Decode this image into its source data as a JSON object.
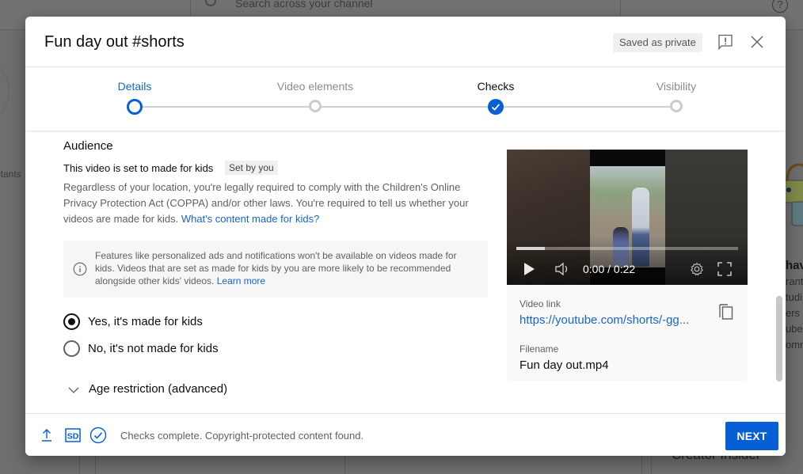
{
  "background": {
    "search_placeholder": "Search across your channel",
    "help_glyph": "?",
    "left_partial_text": "ltants",
    "right_partial_heading": "hav",
    "right_partial_lines": [
      "rant",
      "tudi",
      "ers a",
      "ube.",
      "omn"
    ],
    "creator_partial": "Creator Insider"
  },
  "dialog": {
    "title": "Fun day out #shorts",
    "saved_badge": "Saved as private",
    "feedback_icon": "feedback-icon",
    "close_icon": "close-icon"
  },
  "stepper": {
    "steps": [
      {
        "label": "Details",
        "state": "active"
      },
      {
        "label": "Video elements",
        "state": "pending"
      },
      {
        "label": "Checks",
        "state": "done"
      },
      {
        "label": "Visibility",
        "state": "pending"
      }
    ]
  },
  "audience": {
    "title": "Audience",
    "status": "This video is set to made for kids",
    "set_by_badge": "Set by you",
    "description": "Regardless of your location, you're legally required to comply with the Children's Online Privacy Protection Act (COPPA) and/or other laws. You're required to tell us whether your videos are made for kids. ",
    "description_link": "What's content made for kids?",
    "info_text": "Features like personalized ads and notifications won't be available on videos made for kids. Videos that are set as made for kids by you are more likely to be recommended alongside other kids' videos. ",
    "info_link": "Learn more",
    "options": [
      {
        "label": "Yes, it's made for kids",
        "checked": true
      },
      {
        "label": "No, it's not made for kids",
        "checked": false
      }
    ],
    "age_restriction_label": "Age restriction (advanced)"
  },
  "video": {
    "current_time": "0:00",
    "duration": "0:22",
    "time_display": "0:00 / 0:22",
    "buffered_fraction": 0.13,
    "link_label": "Video link",
    "link": "https://youtube.com/shorts/-gg...",
    "filename_label": "Filename",
    "filename": "Fun day out.mp4"
  },
  "footer": {
    "status": "Checks complete. Copyright-protected content found.",
    "sd_badge": "SD",
    "next_label": "NEXT"
  },
  "colors": {
    "accent": "#065fd4",
    "link": "#1765cc",
    "muted_text": "#606060"
  }
}
